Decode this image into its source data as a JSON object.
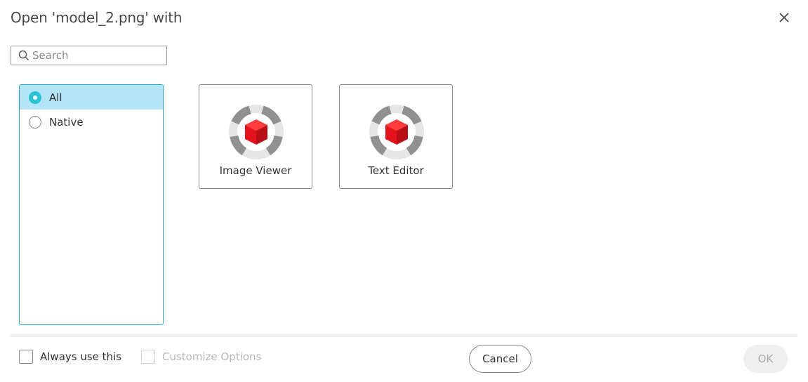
{
  "dialog": {
    "title": "Open 'model_2.png' with",
    "close_icon": "close-icon"
  },
  "search": {
    "placeholder": "Search",
    "value": "",
    "icon": "search-icon"
  },
  "filters": {
    "items": [
      {
        "label": "All",
        "selected": true
      },
      {
        "label": "Native",
        "selected": false
      }
    ]
  },
  "apps": [
    {
      "label": "Image Viewer",
      "icon": "app-logo-icon"
    },
    {
      "label": "Text Editor",
      "icon": "app-logo-icon"
    }
  ],
  "footer": {
    "always_use_label": "Always use this",
    "customize_label": "Customize Options",
    "cancel_label": "Cancel",
    "ok_label": "OK"
  },
  "colors": {
    "accent": "#2bc3d6",
    "selection_bg": "#b3e5f7",
    "list_border": "#2aa7cc",
    "logo_red": "#e3121b",
    "logo_gray": "#8f8f8f"
  }
}
